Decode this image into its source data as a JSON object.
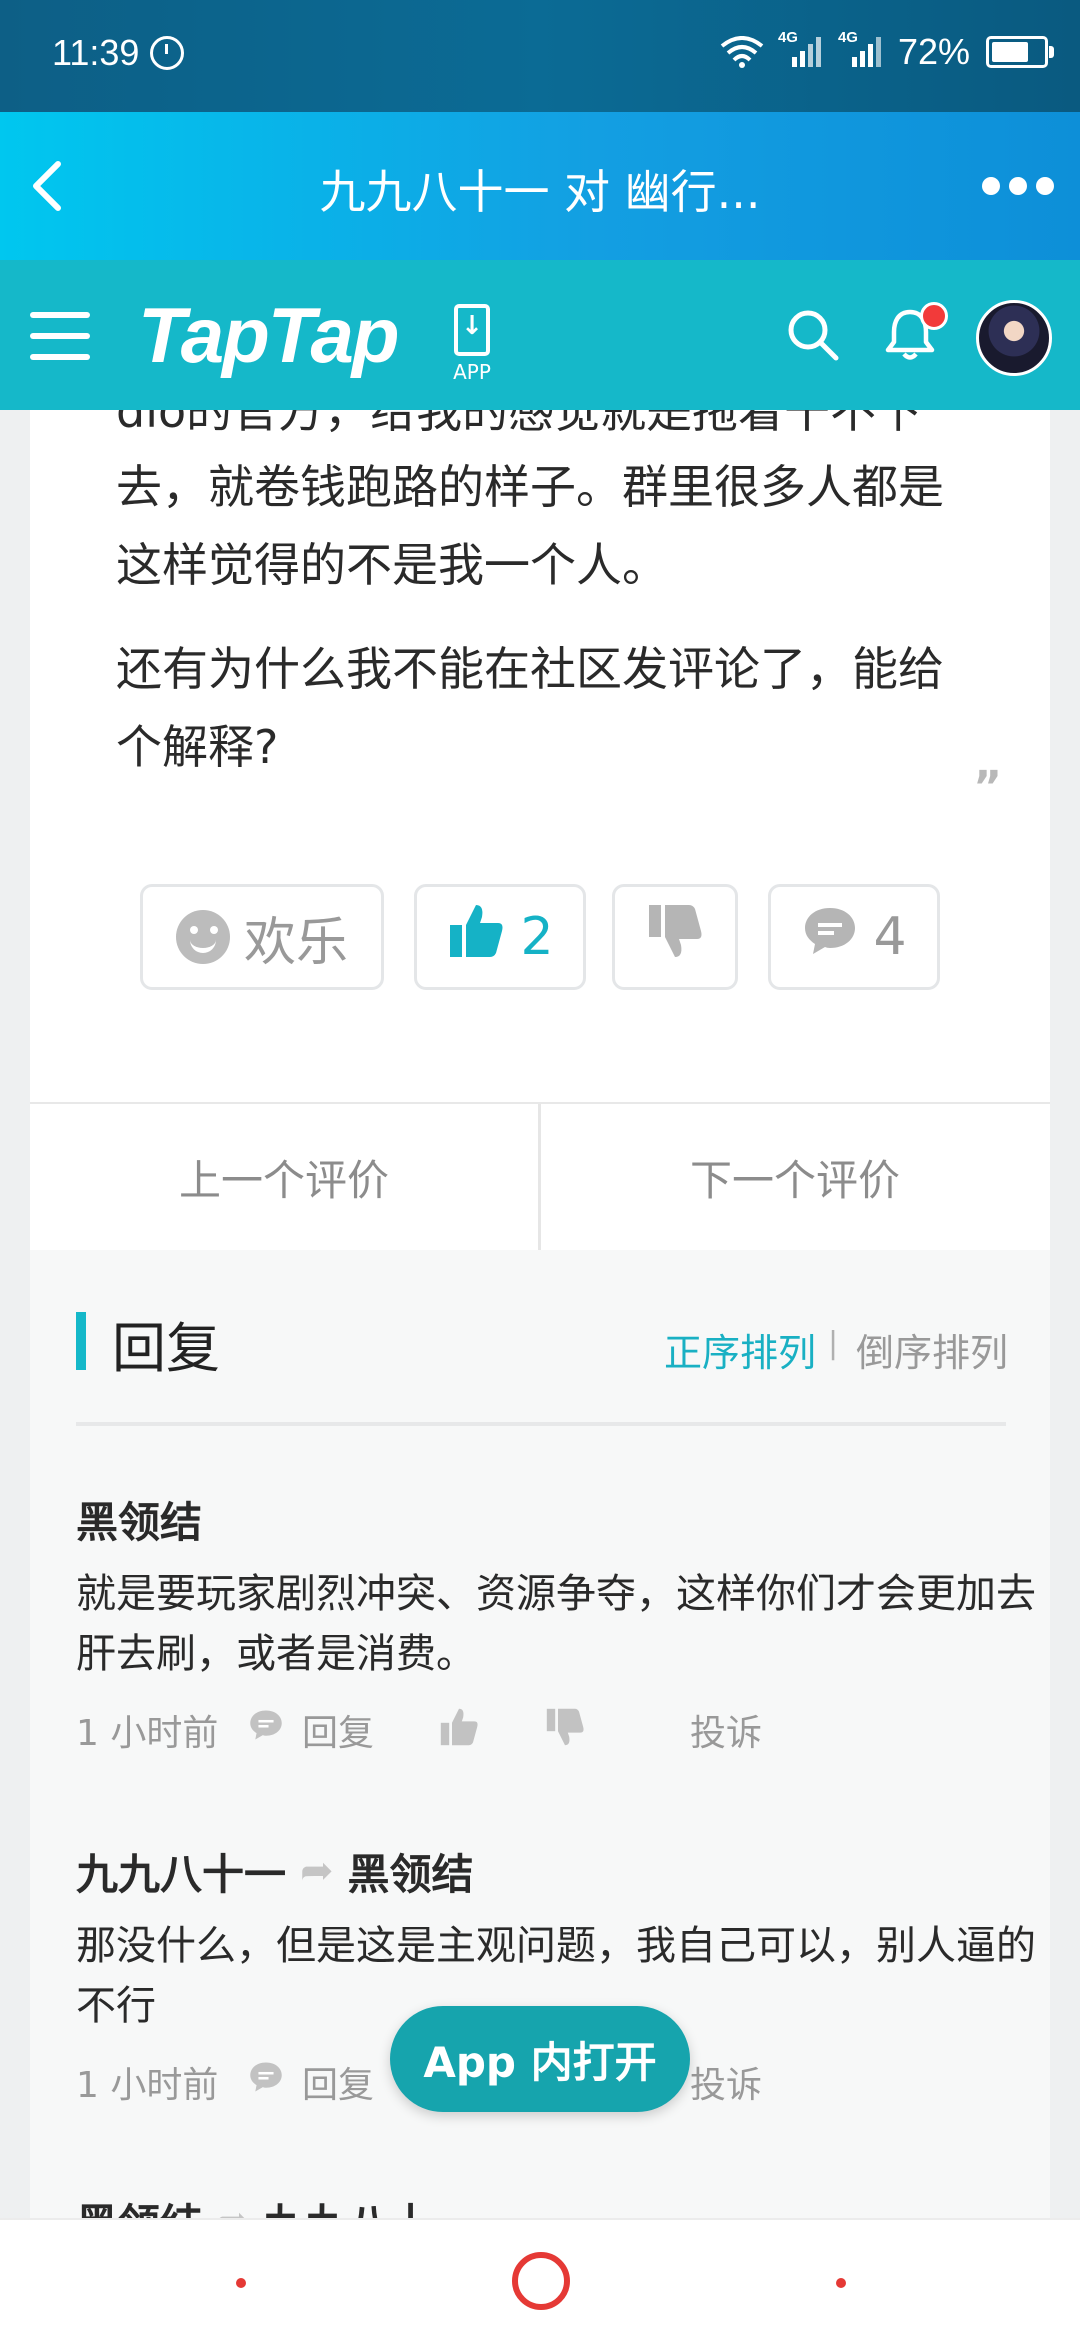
{
  "status_bar": {
    "time": "11:39",
    "network_1": "4G",
    "network_2": "4G",
    "battery": "72%",
    "battery_level": 0.72
  },
  "browser": {
    "title": "九九八十一 对 幽行..."
  },
  "header": {
    "logo": "TapTap",
    "app_download_label": "APP"
  },
  "review": {
    "partial_line": "dlo的官方，给我的感觉就是拖着干不下",
    "paragraph1": "去，就卷钱跑路的样子。群里很多人都是这样觉得的不是我一个人。",
    "paragraph2": "还有为什么我不能在社区发评论了，能给个解释?",
    "quote_mark": "„",
    "reactions": {
      "fun_label": "欢乐",
      "upvotes": "2",
      "comments": "4"
    },
    "prev_label": "上一个评价",
    "next_label": "下一个评价"
  },
  "replies": {
    "title": "回复",
    "sort_asc": "正序排列",
    "sort_separator": "|",
    "sort_desc": "倒序排列",
    "items": [
      {
        "author": "黑领结",
        "text": "就是要玩家剧烈冲突、资源争夺，这样你们才会更加去肝去刷，或者是消费。",
        "time": "1 小时前",
        "reply_label": "回复",
        "report_label": "投诉"
      },
      {
        "author": "九九八十一",
        "reply_to": "黑领结",
        "text": "那没什么，但是这是主观问题，我自己可以，别人逼的不行",
        "time": "1 小时前",
        "reply_label": "回复",
        "report_label": "投诉"
      },
      {
        "author": "黑领结",
        "reply_to": "九九八十一"
      }
    ]
  },
  "open_app_button": "App 内打开",
  "colors": {
    "accent": "#15b8c9",
    "title_bar": "#139fe2",
    "nav_red": "#e53935"
  }
}
